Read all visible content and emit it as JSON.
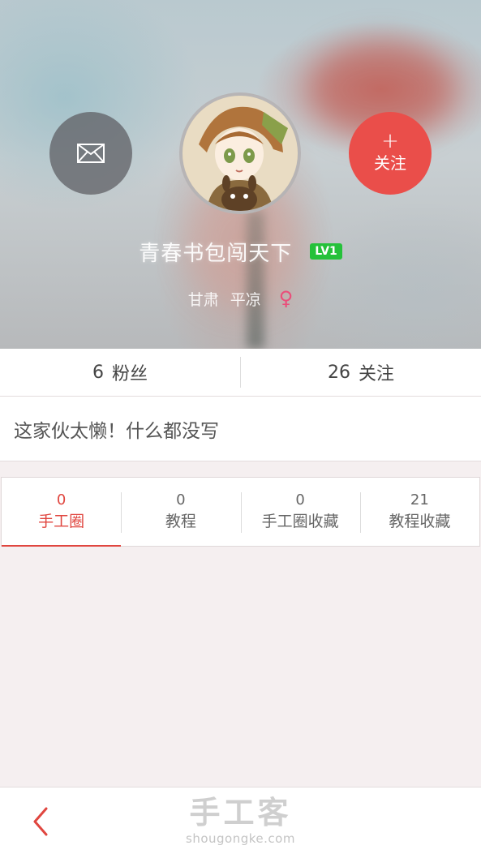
{
  "profile": {
    "nickname": "青春书包闯天下",
    "level": "LV1",
    "province": "甘肃",
    "city": "平凉",
    "gender_symbol": "♀",
    "follow_plus": "+",
    "follow_label": "关注",
    "message_icon": "envelope-icon",
    "avatar": "anime-girl-avatar"
  },
  "stats": {
    "fans_count": "6",
    "fans_label": "粉丝",
    "following_count": "26",
    "following_label": "关注"
  },
  "bio": "这家伙太懒！什么都没写",
  "tabs": [
    {
      "count": "0",
      "label": "手工圈",
      "active": true
    },
    {
      "count": "0",
      "label": "教程",
      "active": false
    },
    {
      "count": "0",
      "label": "手工圈收藏",
      "active": false
    },
    {
      "count": "21",
      "label": "教程收藏",
      "active": false
    }
  ],
  "bottom_bar": {
    "back_icon": "chevron-left-icon",
    "brand_cn": "手工客",
    "brand_en": "shougongke.com"
  },
  "colors": {
    "accent": "#e0463f",
    "follow_button": "#ea4e4a",
    "level_badge": "#25c13a",
    "gender": "#ea4e7a"
  }
}
